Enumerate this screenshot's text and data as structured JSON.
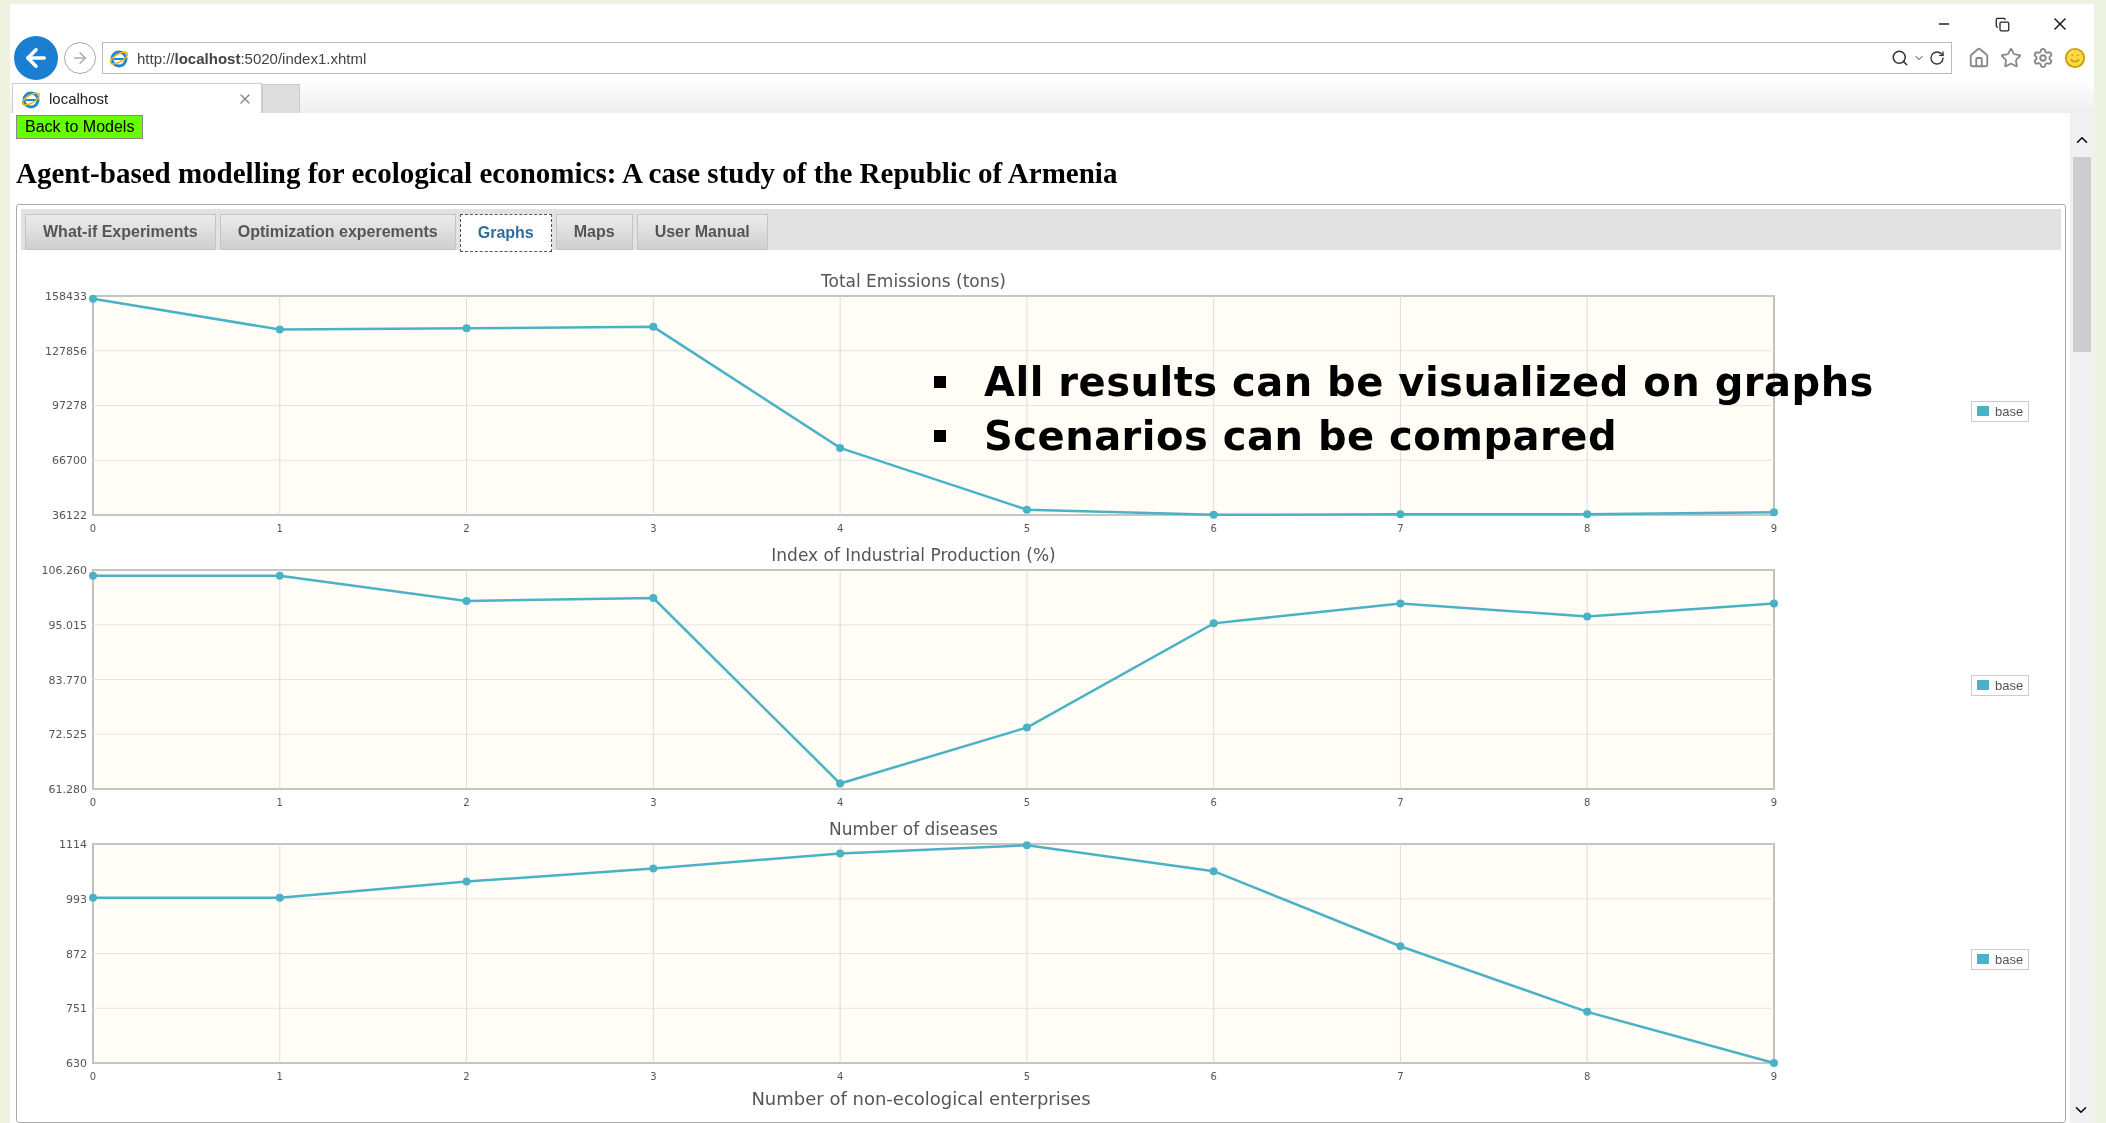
{
  "browser": {
    "url": "http://**localhost**:5020/index1.xhtml",
    "tabs": [
      {
        "title": "localhost",
        "selected": true
      }
    ]
  },
  "page": {
    "back_button": "Back to Models",
    "heading": "Agent-based modelling for ecological economics: A case study of the Republic of Armenia",
    "tabs": [
      {
        "label": "What-if Experiments",
        "selected": false
      },
      {
        "label": "Optimization experements",
        "selected": false
      },
      {
        "label": "Graphs",
        "selected": true
      },
      {
        "label": "Maps",
        "selected": false
      },
      {
        "label": "User Manual",
        "selected": false
      }
    ],
    "charts": [
      {
        "chart_data": {
          "type": "line",
          "title": "Total Emissions (tons)",
          "x": [
            0,
            1,
            2,
            3,
            4,
            5,
            6,
            7,
            8,
            9
          ],
          "xticks": [
            0,
            1,
            2,
            3,
            4,
            5,
            6,
            7,
            8,
            9
          ],
          "ylim": [
            36122,
            158433
          ],
          "yticks": [
            36122,
            66700,
            97278,
            127856,
            158433
          ],
          "xlim": [
            0,
            9
          ],
          "grid": true,
          "series": [
            {
              "name": "base",
              "color": "#4bb2c5",
              "marker": "circle",
              "values": [
                156900,
                139700,
                140400,
                141200,
                73600,
                39100,
                36200,
                36500,
                36600,
                37600
              ]
            }
          ]
        }
      },
      {
        "chart_data": {
          "type": "line",
          "title": "Index of Industrial Production (%)",
          "x": [
            0,
            1,
            2,
            3,
            4,
            5,
            6,
            7,
            8,
            9
          ],
          "xticks": [
            0,
            1,
            2,
            3,
            4,
            5,
            6,
            7,
            8,
            9
          ],
          "ylim": [
            61.28,
            106.26
          ],
          "yticks": [
            {
              "value": 61.28,
              "label": "61.280"
            },
            {
              "value": 72.525,
              "label": "72.525"
            },
            {
              "value": 83.77,
              "label": "83.770"
            },
            {
              "value": 95.015,
              "label": "95.015"
            },
            {
              "value": 106.26,
              "label": "106.260"
            }
          ],
          "xlim": [
            0,
            9
          ],
          "grid": true,
          "series": [
            {
              "name": "base",
              "color": "#4bb2c5",
              "marker": "circle",
              "values": [
                105.1,
                105.1,
                99.9,
                100.5,
                62.4,
                73.9,
                95.3,
                99.4,
                96.7,
                99.4
              ]
            }
          ]
        }
      },
      {
        "chart_data": {
          "type": "line",
          "title": "Number of diseases",
          "x": [
            0,
            1,
            2,
            3,
            4,
            5,
            6,
            7,
            8,
            9
          ],
          "xticks": [
            0,
            1,
            2,
            3,
            4,
            5,
            6,
            7,
            8,
            9
          ],
          "ylim": [
            630,
            1114
          ],
          "yticks": [
            630,
            751,
            872,
            993,
            1114
          ],
          "xlim": [
            0,
            9
          ],
          "grid": true,
          "series": [
            {
              "name": "base",
              "color": "#4bb2c5",
              "marker": "circle",
              "values": [
                995,
                995,
                1031,
                1060,
                1093,
                1111,
                1054,
                888,
                743,
                630
              ]
            }
          ]
        }
      }
    ],
    "next_chart_title": "Number of non-ecological enterprises"
  },
  "overlay": {
    "bullets": [
      "All results can be visualized on graphs",
      "Scenarios can be compared"
    ]
  }
}
